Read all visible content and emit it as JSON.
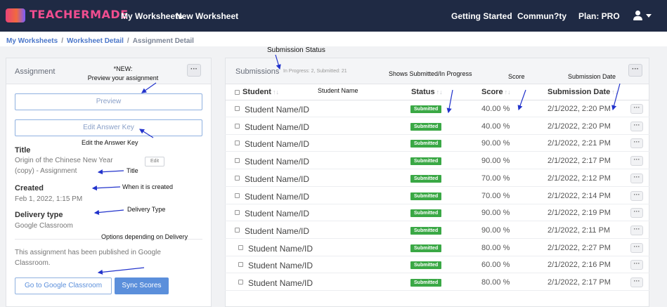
{
  "navbar": {
    "logo_text": "TEACHERMADE",
    "my_worksheets": "My Worksheets",
    "new_worksheet": "New Worksheet",
    "getting_started": "Getting Started",
    "community": "Commun?ty",
    "plan": "Plan: PRO",
    "user_icon": "user-icon",
    "colors": {
      "background": "#1f2a44",
      "logo": "#f04d8f"
    }
  },
  "breadcrumb": {
    "items": [
      "My Worksheets",
      "Worksheet Detail",
      "Assignment Detail"
    ],
    "separator": "/"
  },
  "assignment_panel": {
    "title": "Assignment",
    "more_label": "···",
    "preview_button": "Preview",
    "edit_answer_key_button": "Edit Answer Key",
    "title_label": "Title",
    "title_value_line1": "Origin of the Chinese New Year",
    "title_value_line2": "(copy) - Assignment",
    "edit_button": "Edit",
    "created_label": "Created",
    "created_value": "Feb 1, 2022, 1:15 PM",
    "delivery_label": "Delivery type",
    "delivery_value": "Google Classroom",
    "published_line1": "This assignment has been published in Google",
    "published_line2": "Classroom.",
    "go_to_classroom_button": "Go to Google Classroom",
    "sync_scores_button": "Sync Scores"
  },
  "submissions_panel": {
    "title": "Submissions",
    "summary": "In Progress: 2, Submitted: 21",
    "more_label": "···",
    "columns": [
      "Student",
      "Status",
      "Score",
      "Submission Date"
    ],
    "sort_icon": "↑↓",
    "row_more_label": "···",
    "rows": [
      {
        "student": "Student Name/ID",
        "status": "Submitted",
        "score": "40.00 %",
        "date": "2/1/2022, 2:20 PM"
      },
      {
        "student": "Student Name/ID",
        "status": "Submitted",
        "score": "40.00 %",
        "date": "2/1/2022, 2:20 PM"
      },
      {
        "student": "Student Name/ID",
        "status": "Submitted",
        "score": "90.00 %",
        "date": "2/1/2022, 2:21 PM"
      },
      {
        "student": "Student Name/ID",
        "status": "Submitted",
        "score": "90.00 %",
        "date": "2/1/2022, 2:17 PM"
      },
      {
        "student": "Student Name/ID",
        "status": "Submitted",
        "score": "70.00 %",
        "date": "2/1/2022, 2:12 PM"
      },
      {
        "student": "Student Name/ID",
        "status": "Submitted",
        "score": "70.00 %",
        "date": "2/1/2022, 2:14 PM"
      },
      {
        "student": "Student Name/ID",
        "status": "Submitted",
        "score": "90.00 %",
        "date": "2/1/2022, 2:19 PM"
      },
      {
        "student": "Student Name/ID",
        "status": "Submitted",
        "score": "90.00 %",
        "date": "2/1/2022, 2:11 PM"
      },
      {
        "student": "Student Name/ID",
        "status": "Submitted",
        "score": "80.00 %",
        "date": "2/1/2022, 2:27 PM"
      },
      {
        "student": "Student Name/ID",
        "status": "Submitted",
        "score": "60.00 %",
        "date": "2/1/2022, 2:16 PM"
      },
      {
        "student": "Student Name/ID",
        "status": "Submitted",
        "score": "80.00 %",
        "date": "2/1/2022, 2:17 PM"
      }
    ],
    "status_color": "#3aa845"
  },
  "annotations": {
    "submission_status": "Submission Status",
    "new_line1": "*NEW:",
    "new_line2": "Preview your assignment",
    "student_name": "Student Name",
    "shows_submitted": "Shows Submitted/In Progress",
    "score": "Score",
    "submission_date": "Submission Date",
    "edit_answer_key": "Edit the Answer Key",
    "title": "Title",
    "when_created": "When it is created",
    "delivery_type": "Delivery Type",
    "options_delivery": "Options depending on Delivery",
    "arrow_color": "#2233cc"
  }
}
